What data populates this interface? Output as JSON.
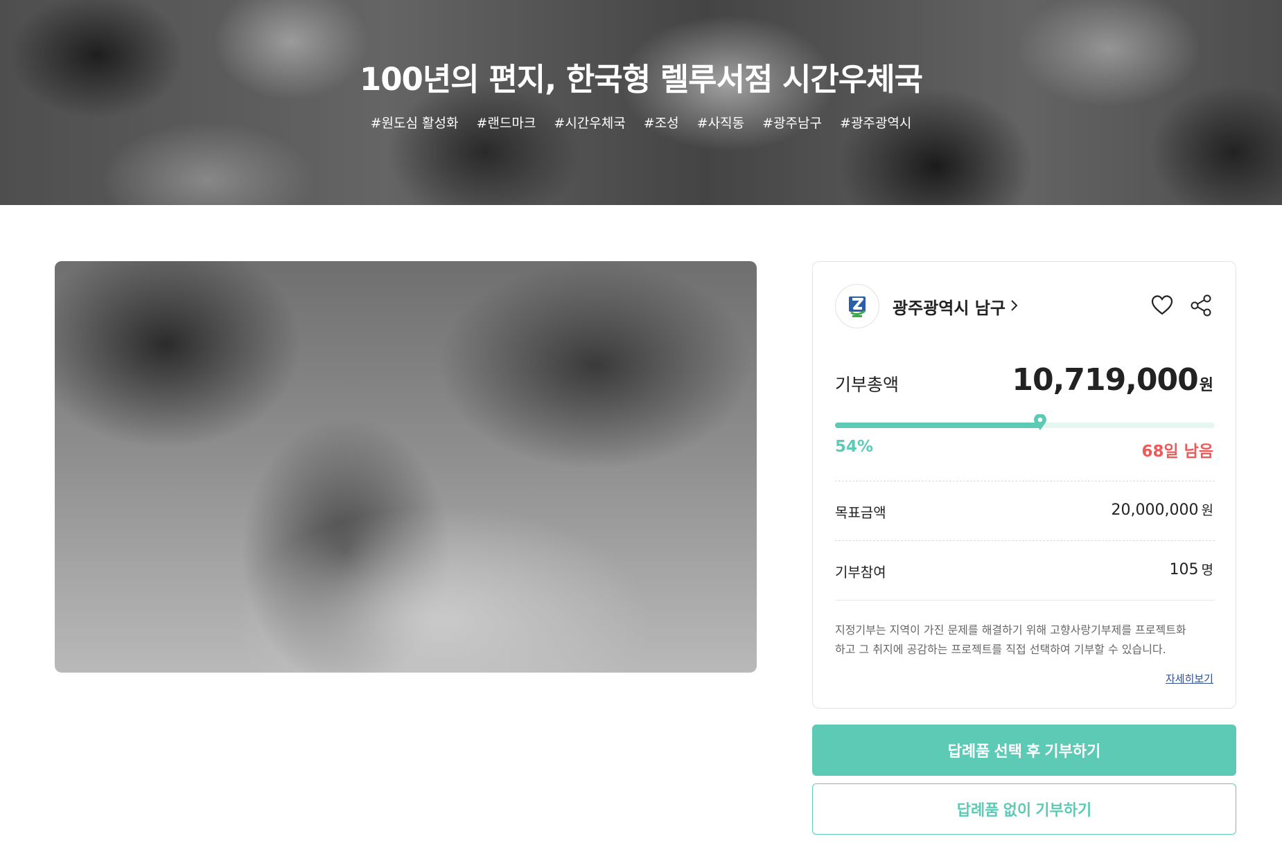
{
  "hero": {
    "title": "100년의 편지, 한국형 렐루서점 시간우체국",
    "tags": [
      "#원도심 활성화",
      "#랜드마크",
      "#시간우체국",
      "#조성",
      "#사직동",
      "#광주남구",
      "#광주광역시"
    ]
  },
  "photo": {
    "icon": "black-and-white-crowd-photo"
  },
  "card": {
    "org_name": "광주광역시 남구",
    "org_logo_icon": "namgu-logo-icon",
    "total_label": "기부총액",
    "total_amount": "10,719,000",
    "total_unit": "원",
    "progress_percent": 54,
    "progress_label": "54%",
    "remaining": "68일 남음",
    "goal_label": "목표금액",
    "goal_value": "20,000,000",
    "goal_unit": "원",
    "participants_label": "기부참여",
    "participants_value": "105",
    "participants_unit": "명",
    "notice_line1": "지정기부는 지역이 가진 문제를 해결하기 위해 고향사랑기부제를 프로젝트화",
    "notice_line2": "하고 그 취지에 공감하는 프로젝트를 직접 선택하여 기부할 수 있습니다.",
    "more_link": "자세히보기"
  },
  "buttons": {
    "with_gift": "답례품 선택 후 기부하기",
    "without_gift": "답례품 없이 기부하기"
  },
  "colors": {
    "accent": "#5ccab5",
    "danger": "#ec5a5a",
    "link": "#2f4f8f"
  }
}
